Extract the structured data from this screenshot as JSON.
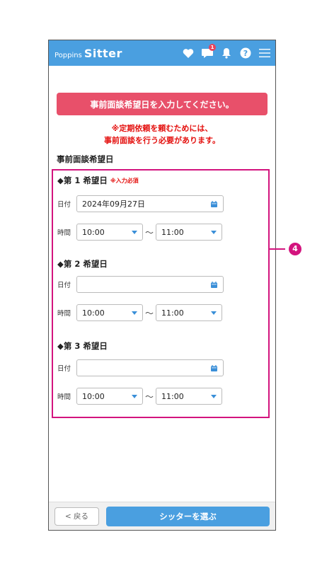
{
  "header": {
    "logo_small": "Poppins",
    "logo_big": "Sitter",
    "message_badge": "1"
  },
  "alert": "事前面談希望日を入力してください。",
  "notice": [
    "※定期依頼を頼むためには、",
    "事前面談を行う必要があります。"
  ],
  "section_title": "事前面談希望日",
  "labels": {
    "date": "日付",
    "time": "時間",
    "tilde": "〜"
  },
  "choices": [
    {
      "title": "◆第 1 希望日",
      "required": "※入力必須",
      "date": "2024年09月27日",
      "start": "10:00",
      "end": "11:00"
    },
    {
      "title": "◆第 2 希望日",
      "date": "",
      "start": "10:00",
      "end": "11:00"
    },
    {
      "title": "◆第 3 希望日",
      "date": "",
      "start": "10:00",
      "end": "11:00"
    }
  ],
  "footer": {
    "back": "< 戻る",
    "next": "シッターを選ぶ"
  },
  "callout": "4",
  "colors": {
    "brand": "#4a9fe0",
    "alert": "#e8506a",
    "warning_text": "#e4100e",
    "highlight": "#d3147e"
  },
  "icons": [
    "heart-icon",
    "chat-icon",
    "bell-icon",
    "help-icon",
    "menu-icon",
    "calendar-icon",
    "chevron-down-icon"
  ]
}
